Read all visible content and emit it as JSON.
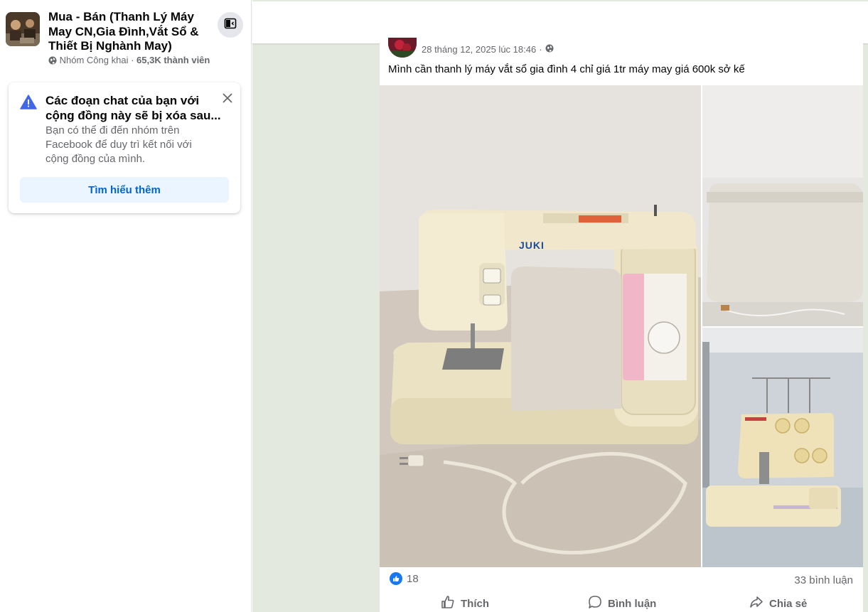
{
  "group": {
    "name": "Mua - Bán (Thanh Lý Máy May CN,Gia Đình,Vắt Sổ & Thiết Bị Nghành May)",
    "privacy": "Nhóm Công khai",
    "separator": "·",
    "members": "65,3K thành viên"
  },
  "notice": {
    "title": "Các đoạn chat của bạn với cộng đồng này sẽ bị xóa sau...",
    "body": "Bạn có thể đi đến nhóm trên Facebook để duy trì kết nối với cộng đồng của mình.",
    "button_label": "Tìm hiểu thêm"
  },
  "post": {
    "timestamp": "28 tháng 12, 2025 lúc 18:46",
    "dot": "·",
    "text": "Mình cần thanh lý máy vắt sổ gia đình 4 chỉ giá 1tr máy may giá 600k sở kế",
    "photo_brand_label": "JUKI",
    "reaction_count": "18",
    "comment_count": "33 bình luận",
    "actions": {
      "like": "Thích",
      "comment": "Bình luận",
      "share": "Chia sẻ"
    }
  },
  "icons": {
    "privacy": "globe-icon",
    "collapse": "sidebar-collapse-icon",
    "warning": "warning-icon",
    "close": "close-icon",
    "like": "thumbs-up-icon",
    "comment": "comment-icon",
    "share": "share-icon"
  },
  "colors": {
    "accent": "#1877f2",
    "link_button_bg": "#ebf5ff",
    "link_button_text": "#0064d1",
    "warning": "#4267e9",
    "muted_text": "#65676b"
  }
}
